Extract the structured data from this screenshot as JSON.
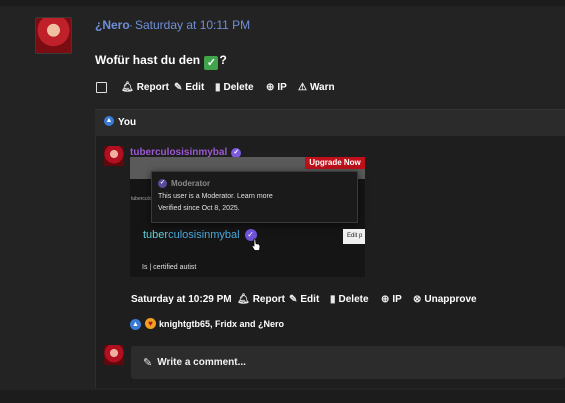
{
  "post": {
    "author": "¿Nero",
    "separator": "·",
    "timestamp": "Saturday at 10:11 PM",
    "text_before": "Wofür hast du den",
    "text_after": "?",
    "emoji": "✓",
    "actions": [
      "Report",
      "Edit",
      "Delete",
      "IP",
      "Warn"
    ]
  },
  "likes": {
    "label": "You"
  },
  "reply": {
    "author": "tuberculosisinmybal",
    "banner_button": "Upgrade Now",
    "card_tiny_text": "tuberculosisinmybal",
    "tooltip": {
      "title": "Moderator",
      "line1": "This user is a Moderator. Learn more",
      "line2": "Verified since Oct 8, 2025."
    },
    "big_name_part1": "tuber",
    "big_name_part2": "culosisinmybal",
    "edit_button": "Edit p",
    "status": "Is | certified autist",
    "timestamp": "Saturday at 10:29 PM",
    "actions": [
      "Report",
      "Edit",
      "Delete",
      "IP",
      "Unapprove"
    ],
    "reactions_text": "knightgtb65, Fridx and ¿Nero"
  },
  "comment": {
    "placeholder": "Write a comment..."
  },
  "colors": {
    "background": "#232323",
    "username": "#6f8fd8",
    "reply_user": "#9b59d0",
    "upgrade": "#c0101a",
    "badge": "#7e5ae0"
  },
  "icons": {
    "report": "bell-icon",
    "edit": "pencil-icon",
    "delete": "trash-icon",
    "ip": "globe-icon",
    "warn": "warning-icon",
    "unapprove": "x-circle-icon",
    "like": "thumbs-up-icon",
    "love": "heart-eyes-icon",
    "verified": "check-badge-icon"
  }
}
